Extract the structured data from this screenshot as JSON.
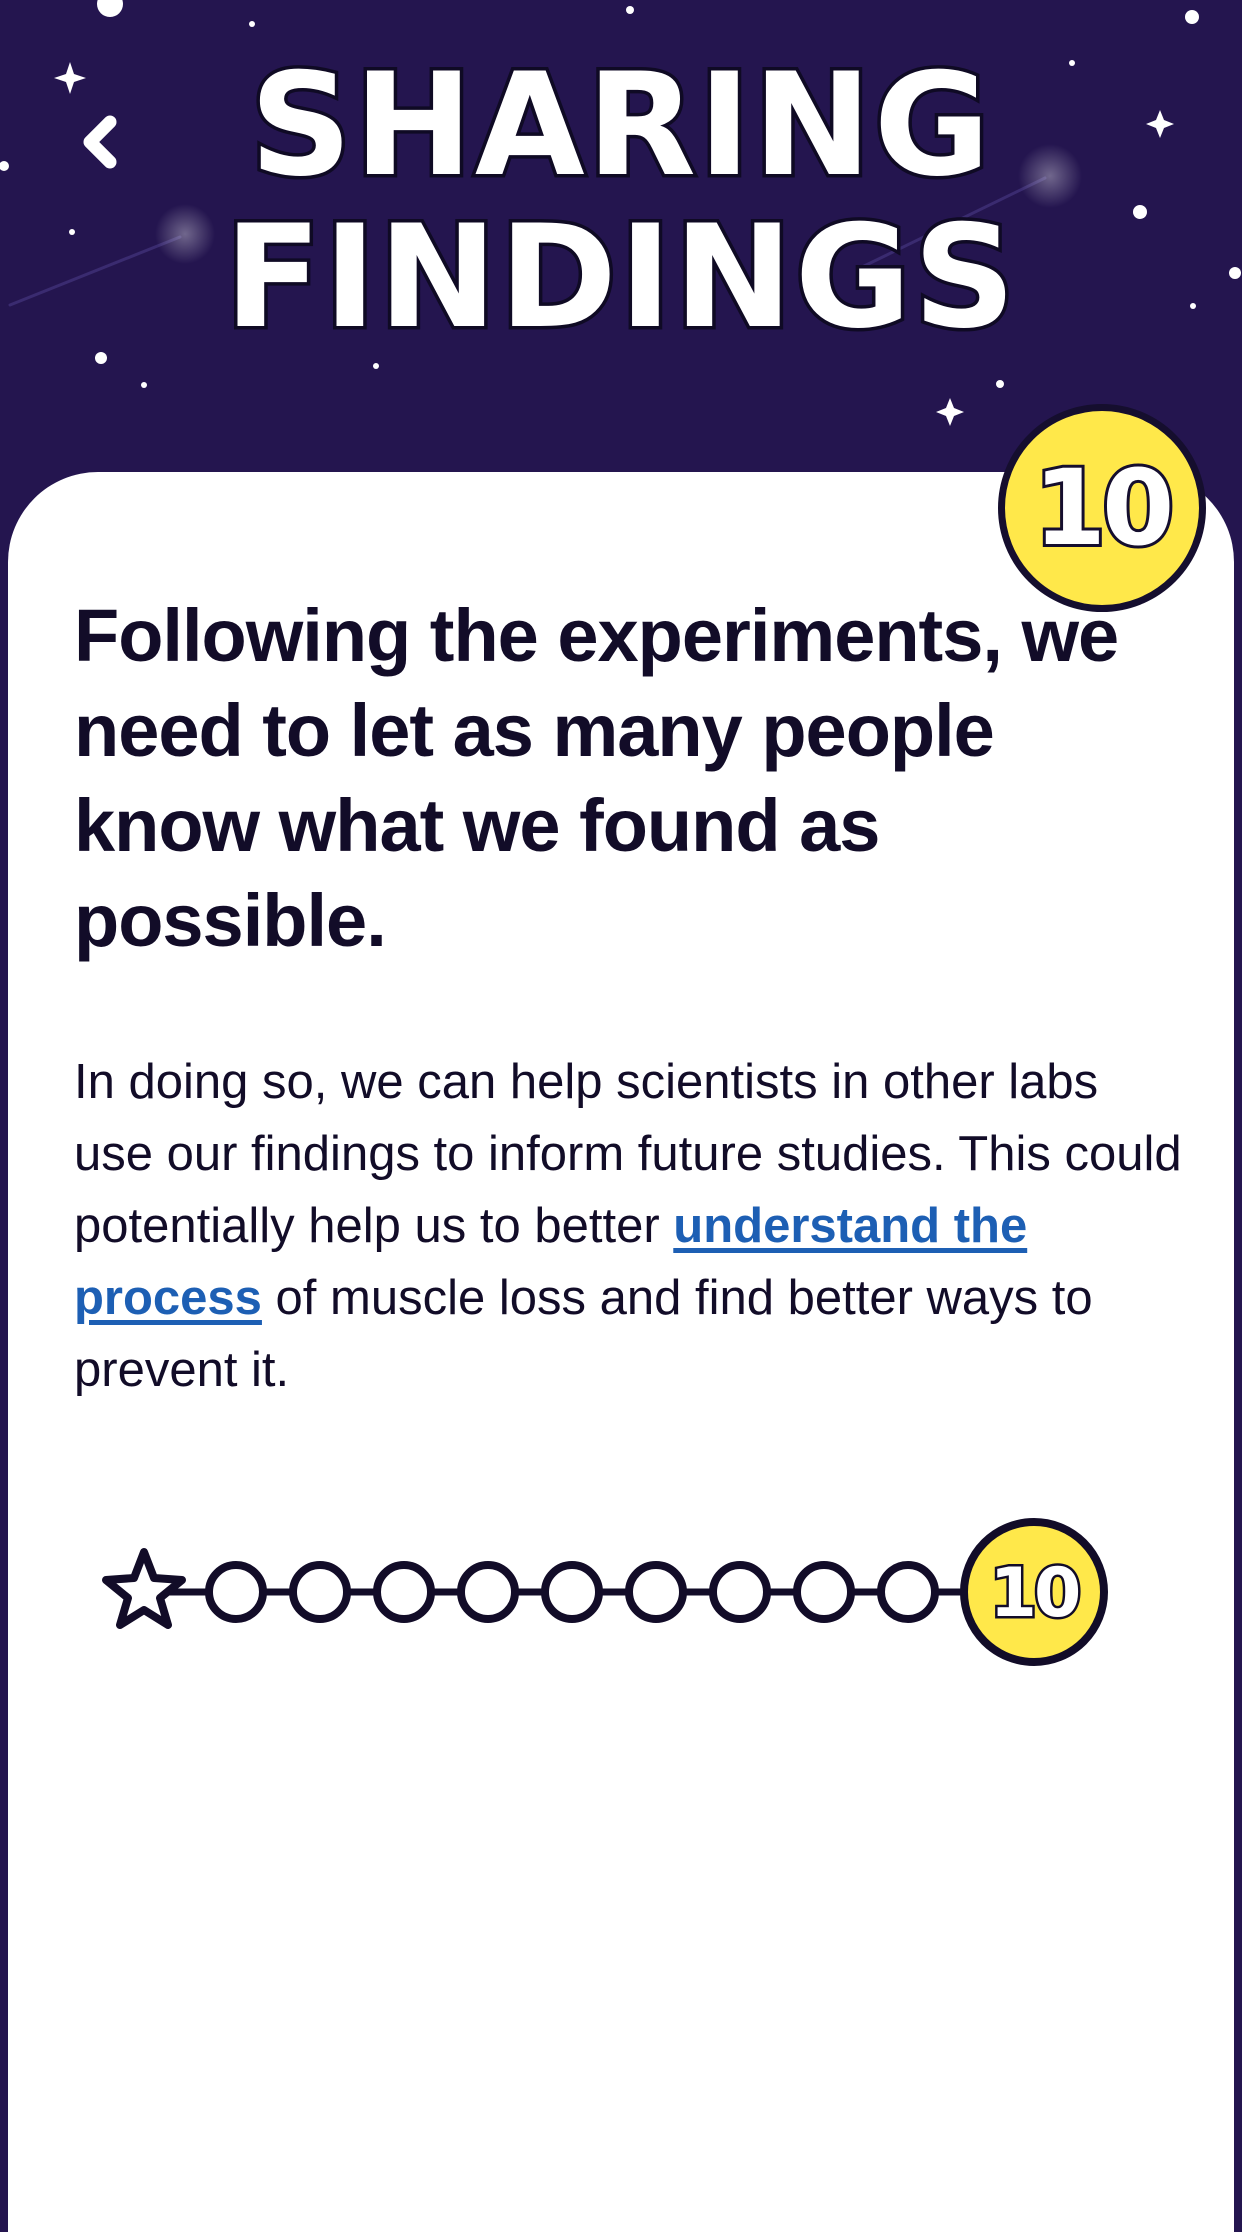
{
  "header": {
    "title_line_1": "Sharing",
    "title_line_2": "Findings",
    "back_icon": "chevron-left-icon",
    "background_color": "#24154f"
  },
  "step": {
    "current": "10",
    "badge_color": "#ffe84a"
  },
  "content": {
    "headline": "Following the experiments, we need to let as many people know what we found as possible.",
    "body_before_link": "In doing so, we can help scientists in other labs use our findings to inform future studies. This could potentially help us to better ",
    "body_link": "understand the process",
    "body_after_link": " of muscle loss and find better ways to prevent it.",
    "link_color": "#1d5fb4"
  },
  "progress": {
    "start_icon": "star-icon",
    "total_steps": 10,
    "current_step": 10,
    "current_label": "10"
  }
}
